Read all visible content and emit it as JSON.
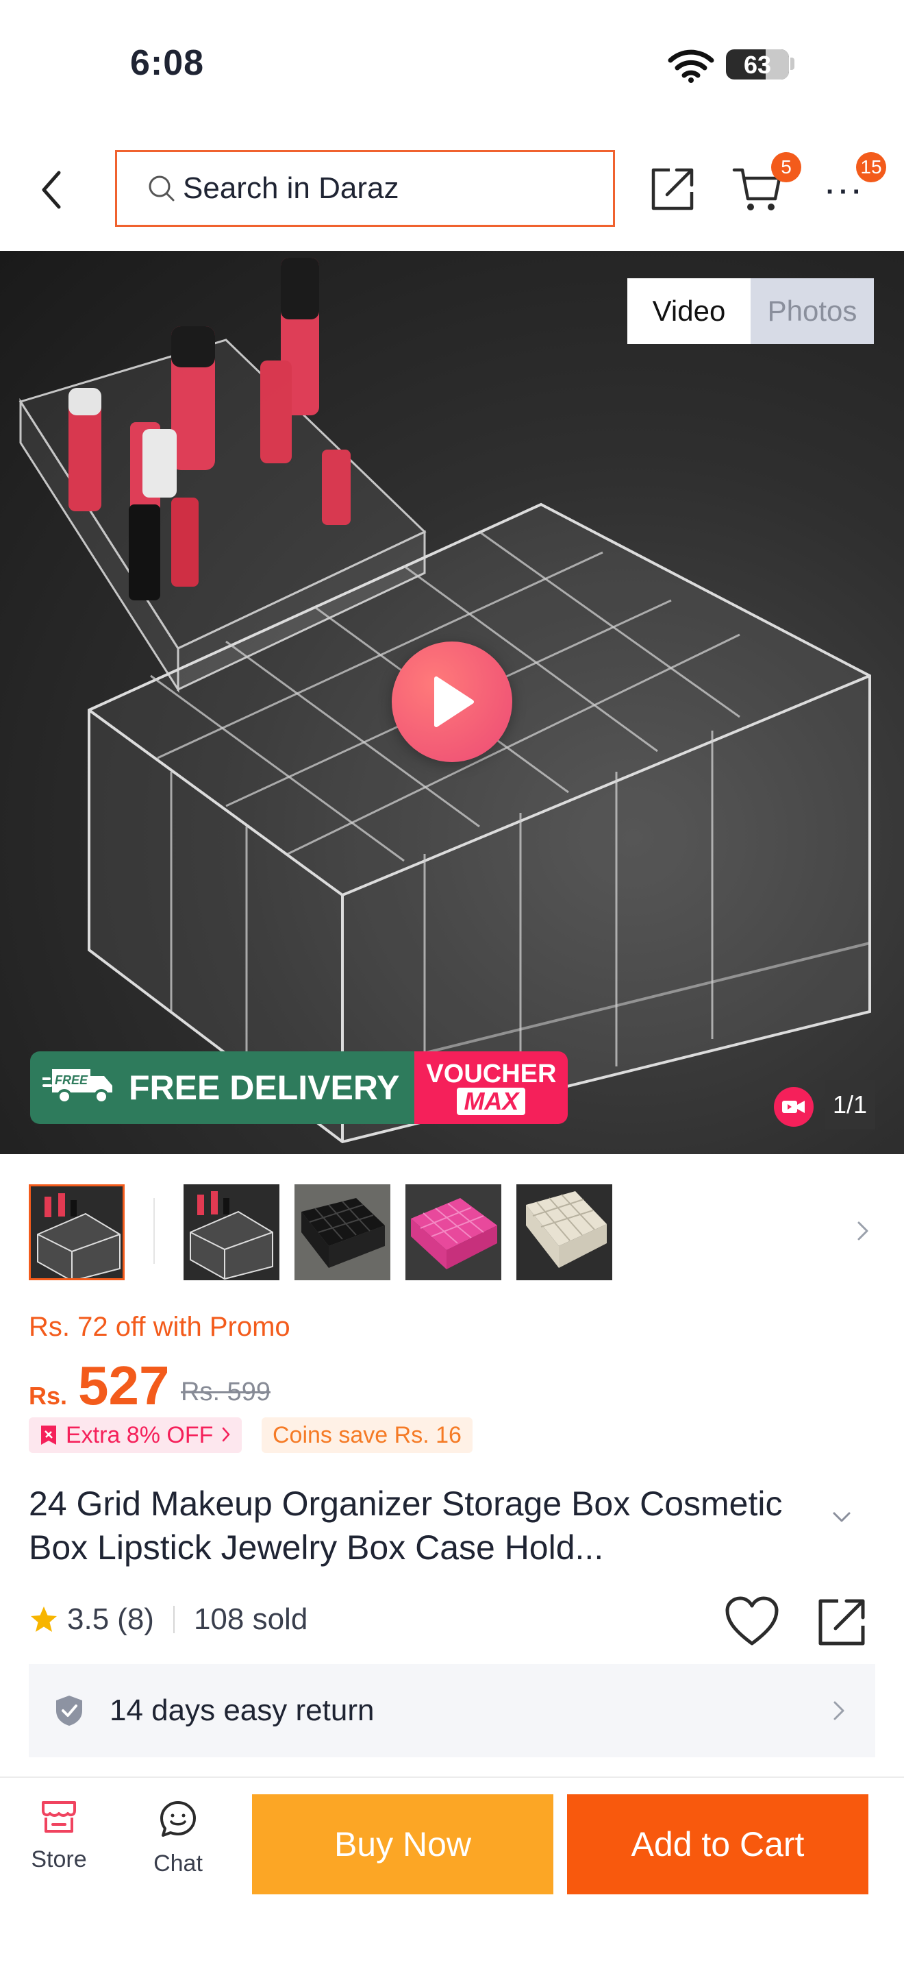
{
  "status_bar": {
    "time": "6:08",
    "battery": "63",
    "battery_level": 0.63
  },
  "header": {
    "search_placeholder": "Search in Daraz",
    "cart_count": "5",
    "more_count": "15"
  },
  "gallery": {
    "segments": [
      "Video",
      "Photos"
    ],
    "active_segment": "Video",
    "delivery_banner": "FREE DELIVERY",
    "truck_label": "FREE",
    "voucher_top": "VOUCHER",
    "voucher_bottom": "MAX",
    "counter": "1/1",
    "thumbnail_icons": [
      "organizer-clear-icon",
      "organizer-clear-icon",
      "organizer-black-icon",
      "organizer-pink-icon",
      "organizer-white-icon"
    ]
  },
  "pricing": {
    "promo": "Rs. 72 off with Promo",
    "currency": "Rs.",
    "price": "527",
    "original_price": "Rs. 599",
    "extra_off": "Extra 8% OFF",
    "coins": "Coins save Rs. 16"
  },
  "product": {
    "title": "24 Grid Makeup Organizer Storage Box Cosmetic Box Lipstick Jewelry Box Case Hold...",
    "rating": "3.5",
    "reviews": "(8)",
    "sold": "108 sold"
  },
  "service": {
    "return_policy": "14 days easy return"
  },
  "bottom_bar": {
    "store": "Store",
    "chat": "Chat",
    "buy_now": "Buy Now",
    "add_to_cart": "Add to Cart"
  },
  "colors": {
    "accent": "#f35b1b",
    "buy_now": "#fca625",
    "add_to_cart": "#f8590d",
    "voucher": "#f5205a",
    "delivery": "#2e7b5c"
  }
}
